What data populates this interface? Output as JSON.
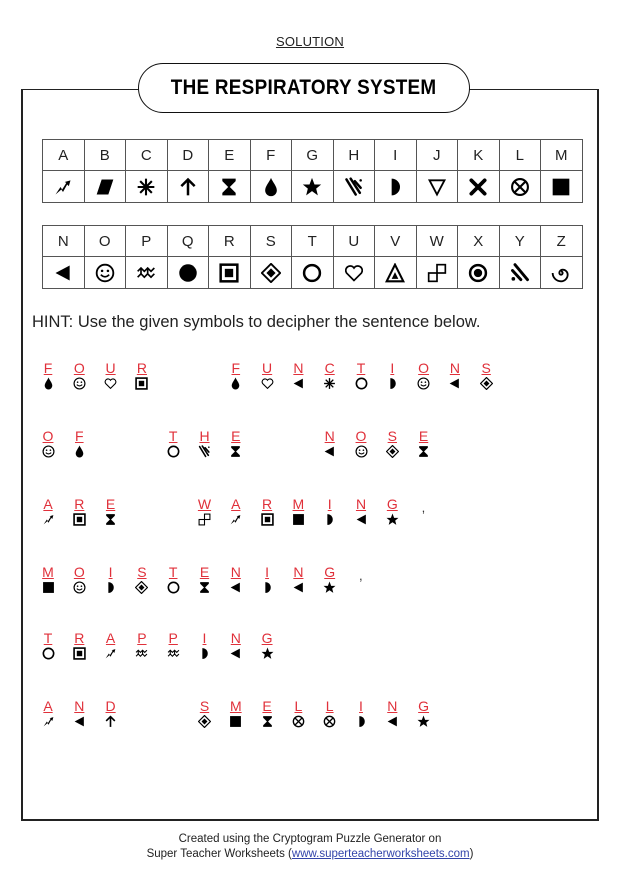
{
  "header": {
    "solution_label": "SOLUTION",
    "title": "THE RESPIRATORY SYSTEM"
  },
  "cipher_key": [
    {
      "letter": "A",
      "symbol": "lightning-icon"
    },
    {
      "letter": "B",
      "symbol": "parallelogram-icon"
    },
    {
      "letter": "C",
      "symbol": "asterisk-icon"
    },
    {
      "letter": "D",
      "symbol": "arrow-up-icon"
    },
    {
      "letter": "E",
      "symbol": "hourglass-icon"
    },
    {
      "letter": "F",
      "symbol": "droplet-icon"
    },
    {
      "letter": "G",
      "symbol": "star-icon"
    },
    {
      "letter": "H",
      "symbol": "stripes-icon"
    },
    {
      "letter": "I",
      "symbol": "half-circle-icon"
    },
    {
      "letter": "J",
      "symbol": "triangle-down-outline-icon"
    },
    {
      "letter": "K",
      "symbol": "x-cross-icon"
    },
    {
      "letter": "L",
      "symbol": "circled-x-icon"
    },
    {
      "letter": "M",
      "symbol": "filled-square-icon"
    },
    {
      "letter": "N",
      "symbol": "triangle-left-icon"
    },
    {
      "letter": "O",
      "symbol": "smiley-icon"
    },
    {
      "letter": "P",
      "symbol": "waves-icon"
    },
    {
      "letter": "Q",
      "symbol": "filled-circle-icon"
    },
    {
      "letter": "R",
      "symbol": "square-in-square-icon"
    },
    {
      "letter": "S",
      "symbol": "diamond-in-diamond-icon"
    },
    {
      "letter": "T",
      "symbol": "ring-icon"
    },
    {
      "letter": "U",
      "symbol": "heart-outline-icon"
    },
    {
      "letter": "V",
      "symbol": "triangle-in-triangle-icon"
    },
    {
      "letter": "W",
      "symbol": "two-squares-icon"
    },
    {
      "letter": "X",
      "symbol": "bullseye-icon"
    },
    {
      "letter": "Y",
      "symbol": "wifi-slash-icon"
    },
    {
      "letter": "Z",
      "symbol": "spiral-icon"
    }
  ],
  "hint": "HINT: Use the given symbols to decipher the sentence below.",
  "puzzle": {
    "lines": [
      {
        "words": [
          "FOUR",
          "FUNCTIONS"
        ],
        "trailing": ""
      },
      {
        "words": [
          "OF",
          "THE",
          "NOSE"
        ],
        "trailing": ""
      },
      {
        "words": [
          "ARE",
          "WARMING"
        ],
        "trailing": ","
      },
      {
        "words": [
          "MOISTENING"
        ],
        "trailing": ","
      },
      {
        "words": [
          "TRAPPING"
        ],
        "trailing": ""
      },
      {
        "words": [
          "AND",
          "SMELLING"
        ],
        "trailing": ""
      }
    ]
  },
  "footer": {
    "line1": "Created using the Cryptogram Puzzle Generator on",
    "line2_prefix": "Super Teacher Worksheets (",
    "link_text": "www.superteacherworksheets.com",
    "line2_suffix": ")"
  },
  "colors": {
    "answer_letter": "#e0303a",
    "symbol": "#000000",
    "border": "#222222",
    "link": "#3344aa"
  }
}
